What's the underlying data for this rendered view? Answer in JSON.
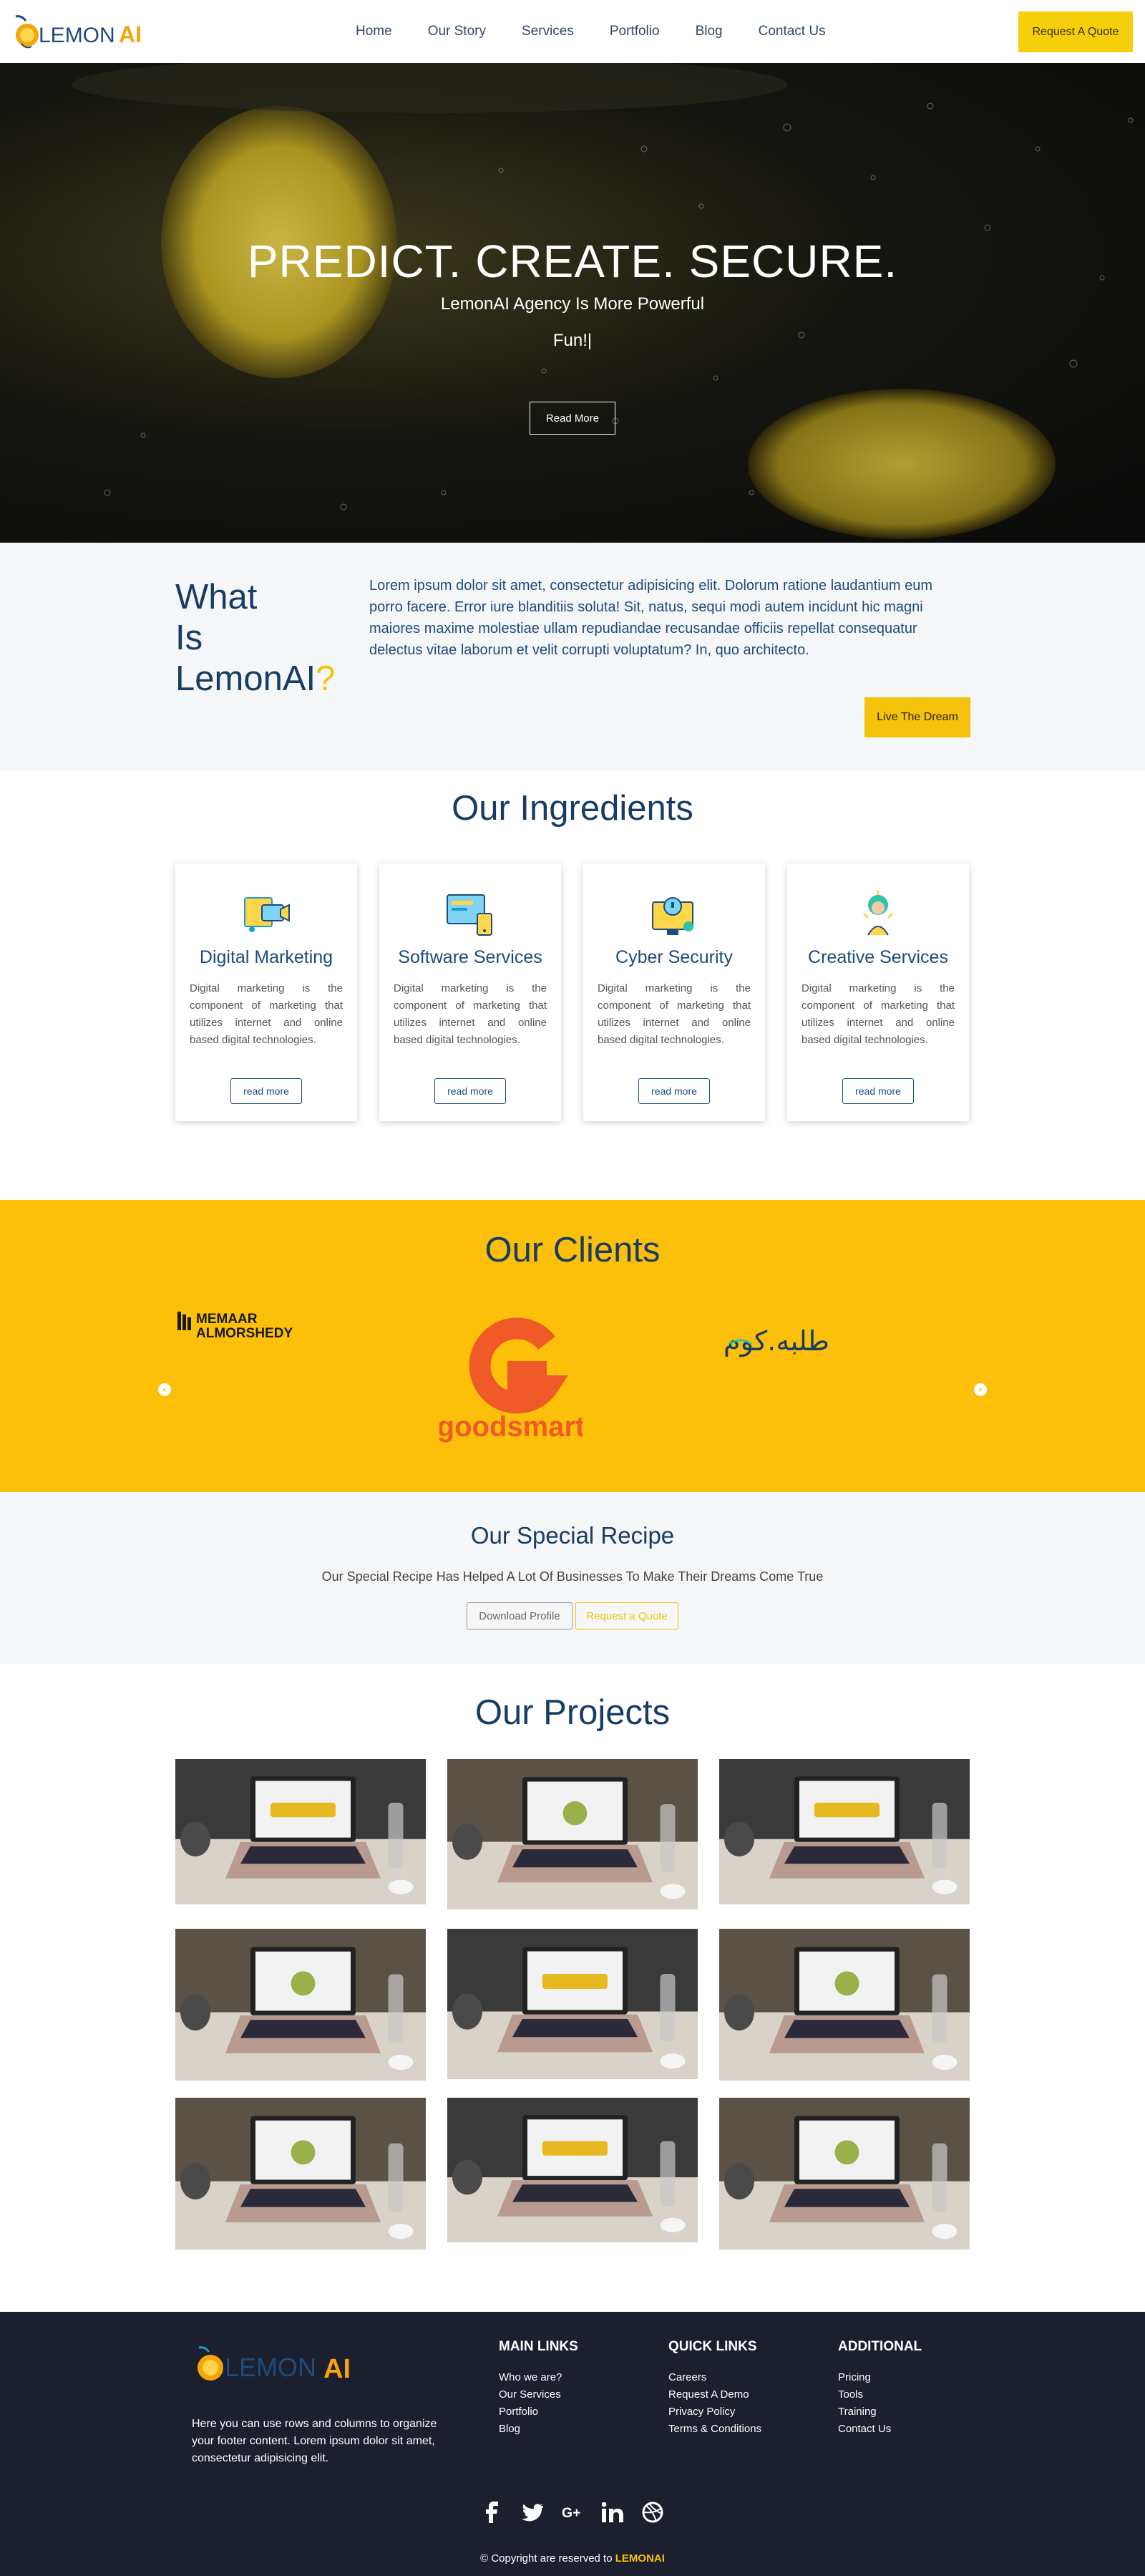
{
  "nav": {
    "links": [
      "Home",
      "Our Story",
      "Services",
      "Portfolio",
      "Blog",
      "Contact Us"
    ],
    "quote_label": "Request A Quote"
  },
  "brand": {
    "name_part1": "LEMON",
    "name_part2": "AI"
  },
  "hero": {
    "title": "PREDICT. CREATE. SECURE.",
    "subtitle": "LemonAI Agency Is More Powerful",
    "typed": "Fun!",
    "button": "Read More"
  },
  "what": {
    "line1": "What",
    "line2": "Is",
    "line3": "LemonAI",
    "mark": "?",
    "text": "Lorem ipsum dolor sit amet, consectetur adipisicing elit. Dolorum ratione laudantium eum porro facere. Error iure blanditiis soluta! Sit, natus, sequi modi autem incidunt hic magni maiores maxime molestiae ullam repudiandae recusandae officiis repellat consequatur delectus vitae laborum et velit corrupti voluptatum? In, quo architecto.",
    "button": "Live The Dream"
  },
  "ingredients": {
    "title": "Our Ingredients",
    "cards": [
      {
        "title": "Digital Marketing",
        "text": "Digital marketing is the component of marketing that utilizes internet and online based digital technologies.",
        "button": "read more"
      },
      {
        "title": "Software Services",
        "text": "Digital marketing is the component of marketing that utilizes internet and online based digital technologies.",
        "button": "read more"
      },
      {
        "title": "Cyber Security",
        "text": "Digital marketing is the component of marketing that utilizes internet and online based digital technologies.",
        "button": "read more"
      },
      {
        "title": "Creative Services",
        "text": "Digital marketing is the component of marketing that utilizes internet and online based digital technologies.",
        "button": "read more"
      }
    ]
  },
  "clients": {
    "title": "Our Clients",
    "c1_line1": "MEMAAR",
    "c1_line2": "ALMORSHEDY",
    "c2": "goodsmart",
    "c3": "طلبه.كوم"
  },
  "recipe": {
    "title": "Our Special Recipe",
    "text": "Our Special Recipe Has Helped A Lot Of Businesses To Make Their Dreams Come True",
    "download": "Download Profile",
    "request": "Request a Quote"
  },
  "projects": {
    "title": "Our Projects"
  },
  "footer": {
    "about": "Here you can use rows and columns to organize your footer content. Lorem ipsum dolor sit amet, consectetur adipisicing elit.",
    "main_title": "MAIN LINKS",
    "main_links": [
      "Who we are?",
      "Our Services",
      "Portfolio",
      "Blog"
    ],
    "quick_title": "QUICK LINKS",
    "quick_links": [
      "Careers",
      "Request A Demo",
      "Privacy Policy",
      "Terms & Conditions"
    ],
    "add_title": "ADDITIONAL",
    "add_links": [
      "Pricing",
      "Tools",
      "Training",
      "Contact Us"
    ],
    "copy_prefix": "© Copyright are reserved to",
    "copy_brand": "LEMONAI"
  },
  "colors": {
    "accent": "#f5c20c",
    "navy": "#173d64",
    "footer_bg": "#1c1f2e",
    "clients_bg": "#fcbf0a"
  }
}
